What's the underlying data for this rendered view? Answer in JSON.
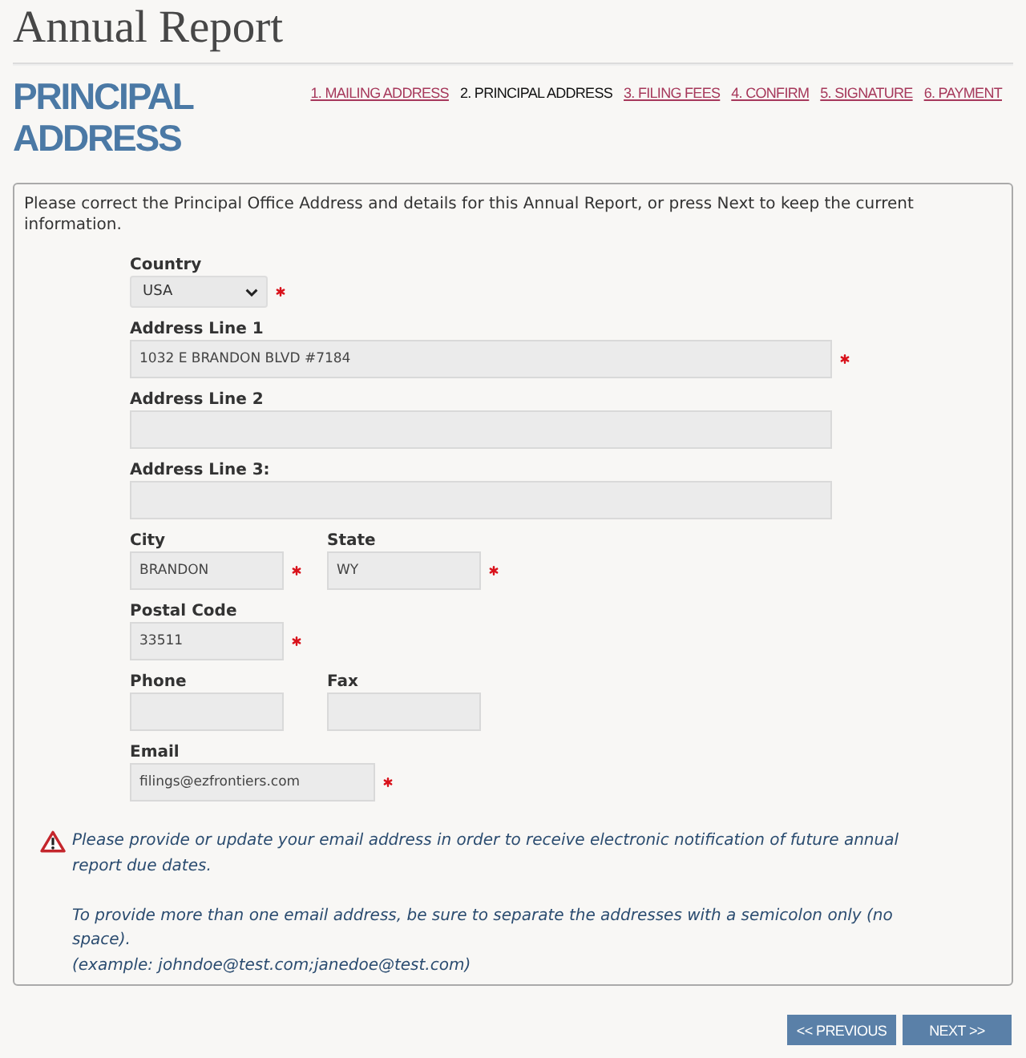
{
  "page": {
    "title": "Annual Report"
  },
  "header": {
    "heading": "PRINCIPAL ADDRESS",
    "steps": [
      {
        "label": "1. MAILING ADDRESS",
        "selected": false
      },
      {
        "label": "2. PRINCIPAL ADDRESS",
        "selected": true
      },
      {
        "label": "3. FILING FEES",
        "selected": false
      },
      {
        "label": "4. CONFIRM",
        "selected": false
      },
      {
        "label": "5. SIGNATURE",
        "selected": false
      },
      {
        "label": "6. PAYMENT",
        "selected": false
      }
    ]
  },
  "form": {
    "intro": "Please correct the Principal Office Address and details for this Annual Report, or press Next to keep the current information.",
    "rows": [
      {
        "fields": [
          {
            "kind": "select",
            "label": "Country",
            "value": "USA",
            "required": true
          }
        ]
      },
      {
        "fields": [
          {
            "kind": "address",
            "label": "Address Line 1",
            "value": "1032 E BRANDON BLVD #7184",
            "required": true
          }
        ]
      },
      {
        "fields": [
          {
            "kind": "address",
            "label": "Address Line 2"
          }
        ]
      },
      {
        "fields": [
          {
            "kind": "address",
            "label": "Address Line 3:"
          }
        ]
      },
      {
        "fields": [
          {
            "kind": "short",
            "label": "City",
            "value": "BRANDON",
            "required": true
          },
          {
            "kind": "short",
            "label": "State",
            "value": "WY",
            "required": true
          }
        ]
      },
      {
        "fields": [
          {
            "kind": "short",
            "label": "Postal Code",
            "value": "33511",
            "required": true
          }
        ]
      },
      {
        "fields": [
          {
            "kind": "short",
            "label": "Phone"
          },
          {
            "kind": "short",
            "label": "Fax"
          }
        ]
      },
      {
        "fields": [
          {
            "kind": "email",
            "label": "Email",
            "value": "filings@ezfrontiers.com",
            "required": true
          }
        ]
      }
    ]
  },
  "notice": {
    "paragraphs": [
      [
        "Please provide or update your email address in order to receive electronic notification of future annual report due dates."
      ],
      [
        "To provide more than one email address, be sure to separate the addresses with a semicolon only (no space).",
        "(example: johndoe@test.com;janedoe@test.com)"
      ]
    ]
  },
  "buttons": [
    {
      "label": "<< PREVIOUS"
    },
    {
      "label": "NEXT >>"
    }
  ]
}
